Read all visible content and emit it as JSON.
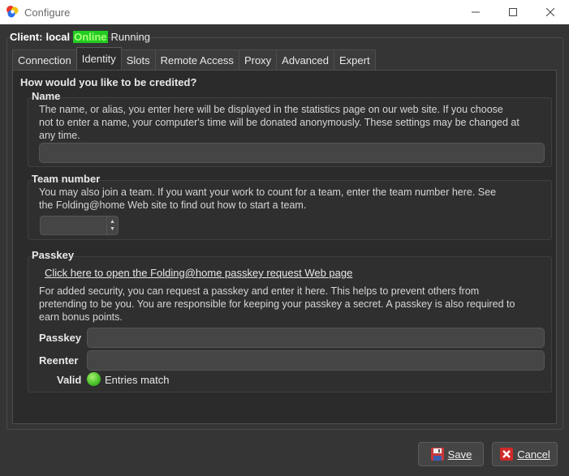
{
  "window": {
    "title": "Configure"
  },
  "client": {
    "label": "Client:",
    "host": "local",
    "online": "Online",
    "status": "Running"
  },
  "tabs": [
    {
      "label": "Connection"
    },
    {
      "label": "Identity"
    },
    {
      "label": "Slots"
    },
    {
      "label": "Remote Access"
    },
    {
      "label": "Proxy"
    },
    {
      "label": "Advanced"
    },
    {
      "label": "Expert"
    }
  ],
  "identity": {
    "heading": "How would you like to be credited?",
    "name": {
      "title": "Name",
      "desc_line1": "The name, or alias, you enter here will be displayed in the statistics page on our web site.  If you choose",
      "desc_line2": "not to enter a name, your computer's time will be donated anonymously.  These settings may be changed at",
      "desc_line3": "any time.",
      "value": ""
    },
    "team": {
      "title": "Team number",
      "desc_line1": "You may also join a team.  If you want your work to count for a team, enter the team number here.  See",
      "desc_line2": "the Folding@home Web site to find out how to start a team.",
      "value": ""
    },
    "passkey": {
      "title": "Passkey",
      "link": "Click here to open the Folding@home passkey request Web page",
      "desc_line1": "For added security, you can request a passkey and enter it here.  This helps to prevent others from",
      "desc_line2": "pretending to be you.  You are responsible for keeping your passkey a secret.  A passkey is also required to",
      "desc_line3": "earn bonus points.",
      "passkey_label": "Passkey",
      "reenter_label": "Reenter",
      "valid_label": "Valid",
      "valid_text": "Entries match"
    }
  },
  "buttons": {
    "save": "Save",
    "cancel": "Cancel"
  },
  "colors": {
    "online_bg": "#22cc22",
    "valid": "#4cc42a"
  }
}
